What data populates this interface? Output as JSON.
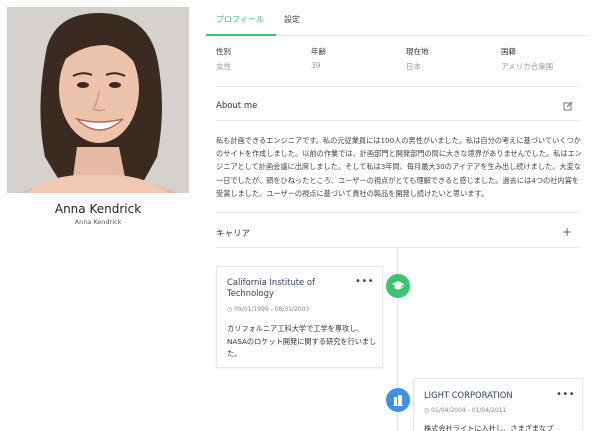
{
  "profile": {
    "name": "Anna Kendrick",
    "subname": "Anna Kendrick"
  },
  "tabs": [
    {
      "label": "プロフィール"
    },
    {
      "label": "設定"
    }
  ],
  "info": [
    {
      "label": "性別",
      "value": "女性"
    },
    {
      "label": "年齢",
      "value": "39"
    },
    {
      "label": "現在地",
      "value": "日本"
    },
    {
      "label": "国籍",
      "value": "アメリカ合衆国"
    }
  ],
  "about": {
    "title": "About me",
    "text": "私も計画できるエンジニアです。私の元従業員には100人の男性がいました。私は自分の考えに基づいていくつかのサイトを作成しました。以前の作業では、計画部門と開発部門の間に大きな境界がありませんでした。私はエンジニアとして計画会議に出席しました。そして私は3年間、毎月最大30のアイデアを生み出し続けました。大変な一日でしたが、頭をひねったところ、ユーザーの視点がとても理解できると感じました。過去には4つの社内賞を受賞しました。ユーザーの視点に基づいて貴社の製品を開発し続けたいと思います。"
  },
  "career": {
    "title": "キャリア",
    "items": [
      {
        "title": "California Institute of Technology",
        "date": "09/01/1999 - 08/31/2003",
        "body": "カリフォルニア工科大学で工学を専攻し、NASAのロケット開発に関する研究を行いました。",
        "icon": "graduation-cap-icon",
        "color": "#3cc36f"
      },
      {
        "title": "LIGHT CORPORATION",
        "date": "01/04/2004 - 01/04/2011",
        "body": "株式会社ライトに入社し、さまざまなプ",
        "icon": "building-icon",
        "color": "#3d8fe8"
      }
    ]
  },
  "more_label": "•••"
}
